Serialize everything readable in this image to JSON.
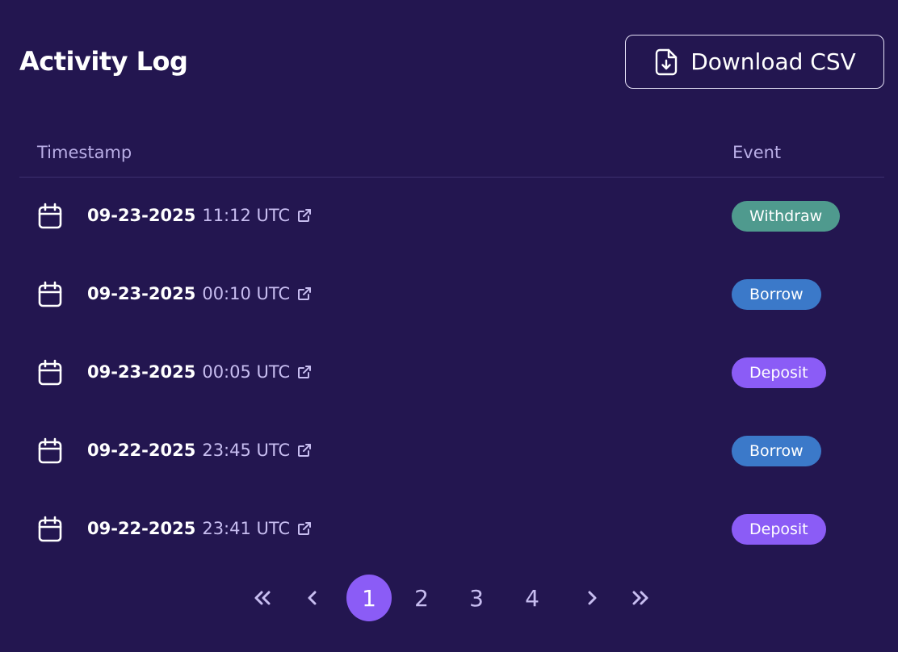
{
  "header": {
    "title": "Activity Log",
    "download_label": "Download CSV"
  },
  "table": {
    "columns": [
      "Timestamp",
      "Event"
    ],
    "rows": [
      {
        "date": "09-23-2025",
        "time": "11:12 UTC",
        "event": "Withdraw",
        "event_color": "#4f9a8e"
      },
      {
        "date": "09-23-2025",
        "time": "00:10 UTC",
        "event": "Borrow",
        "event_color": "#3b79c9"
      },
      {
        "date": "09-23-2025",
        "time": "00:05 UTC",
        "event": "Deposit",
        "event_color": "#8b5cf6"
      },
      {
        "date": "09-22-2025",
        "time": "23:45 UTC",
        "event": "Borrow",
        "event_color": "#3b79c9"
      },
      {
        "date": "09-22-2025",
        "time": "23:41 UTC",
        "event": "Deposit",
        "event_color": "#8b5cf6"
      }
    ]
  },
  "pagination": {
    "pages": [
      "1",
      "2",
      "3",
      "4"
    ],
    "current": "1"
  },
  "colors": {
    "background": "#231650",
    "accent": "#8b5cf6",
    "muted_text": "#c7bdf0"
  },
  "icons": {
    "download": "file-download-icon",
    "calendar": "calendar-icon",
    "external": "external-link-icon",
    "first": "double-chevron-left-icon",
    "prev": "chevron-left-icon",
    "next": "chevron-right-icon",
    "last": "double-chevron-right-icon"
  }
}
